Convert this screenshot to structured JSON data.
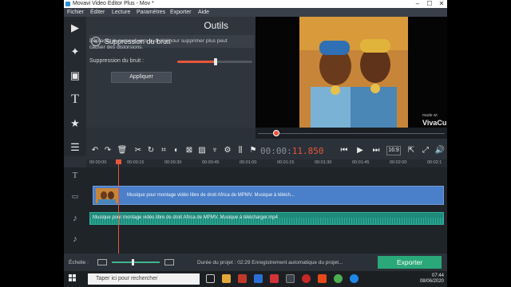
{
  "window": {
    "title": "Movavi Video Editor Plus - Mov *",
    "minimize": "–",
    "maximize": "☐",
    "close": "✕"
  },
  "menu": [
    "Fichier",
    "Éditer",
    "Lecture",
    "Paramètres",
    "Exporter",
    "Aide"
  ],
  "sidebar": [
    {
      "name": "import-icon",
      "glyph": "▶"
    },
    {
      "name": "magic-wand-icon",
      "glyph": "✦"
    },
    {
      "name": "filters-icon",
      "glyph": "▣"
    },
    {
      "name": "titles-icon",
      "glyph": "T"
    },
    {
      "name": "stickers-icon",
      "glyph": "★"
    },
    {
      "name": "more-tools-icon",
      "glyph": "☰"
    }
  ],
  "panel": {
    "title": "Outils",
    "section": "Suppression du bruit",
    "back_glyph": "«",
    "description": "Déplacez le curseur vers la droite pour supprimer plus peut causer des distorsions.",
    "slider_label": "Suppression du bruit :",
    "slider_level": 0.51,
    "apply_label": "Appliquer"
  },
  "preview": {
    "watermark_small": "made wi",
    "watermark_brand": "VivaCu",
    "scrub_position": 0.1
  },
  "toolbar": {
    "time_prefix": "00:00:",
    "time_value": "11.850",
    "aspect_ratio": "16:9",
    "icons": [
      "undo-icon",
      "redo-icon",
      "delete-icon",
      "cut-icon",
      "rotate-icon",
      "crop-icon",
      "color-icon",
      "transition-icon",
      "image-icon",
      "microphone-icon",
      "settings-icon",
      "equalizer-icon",
      "flag-icon"
    ]
  },
  "playback": {
    "prev": "⏮",
    "play": "▶",
    "next": "⏭"
  },
  "ruler": [
    "00:00:00",
    "00:00:15",
    "00:00:30",
    "00:00:45",
    "00:01:00",
    "00:01:15",
    "00:01:30",
    "00:01:45",
    "00:02:00",
    "00:02:1"
  ],
  "timeline": {
    "video_clip": "Musique pour montage vidéo libre de droit  Africa  de MPMV. Musique à téléch...",
    "audio_clip": "Musique pour montage vidéo libre de droit  Africa  de MPMV. Musique à télécharger.mp4",
    "playhead_seconds": 11.85
  },
  "status": {
    "scale_label": "Échelle :",
    "zoom_level": 0.42,
    "duration": "Durée du projet : 02:29  Enregistrement automatique du projet...",
    "export_label": "Exporter"
  },
  "taskbar": {
    "search_placeholder": "Taper ici pour rechercher",
    "time": "07:44",
    "date": "08/06/2020"
  }
}
